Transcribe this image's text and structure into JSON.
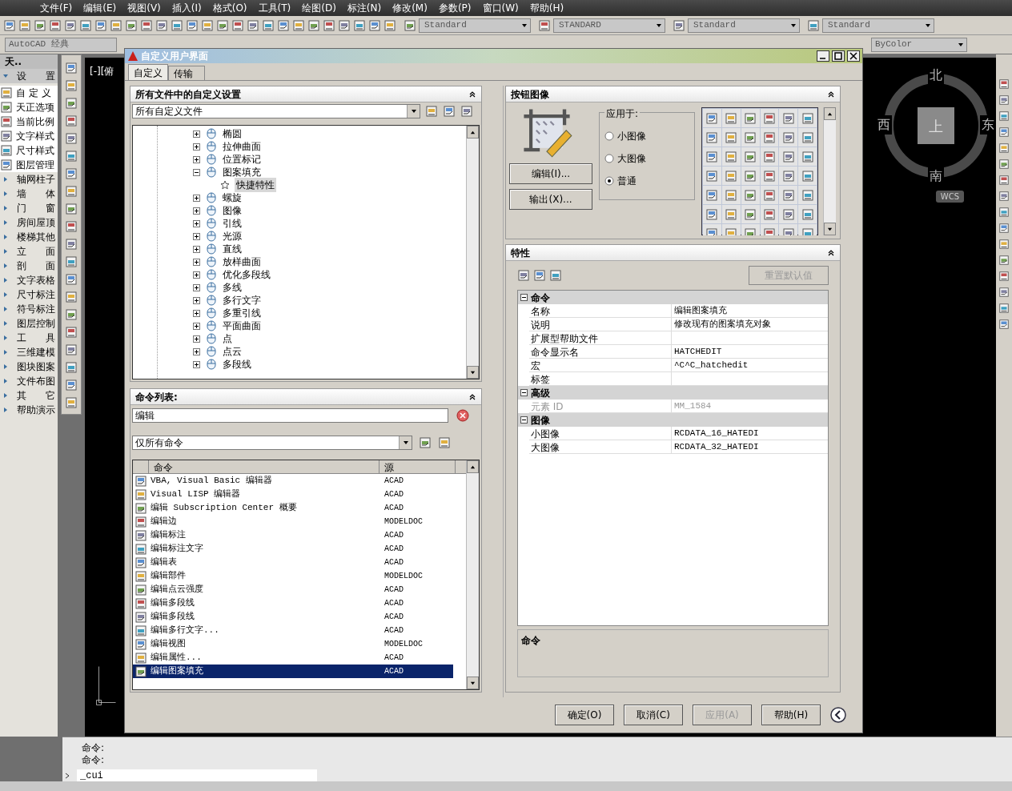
{
  "menu": [
    "文件(F)",
    "编辑(E)",
    "视图(V)",
    "插入(I)",
    "格式(O)",
    "工具(T)",
    "绘图(D)",
    "标注(N)",
    "修改(M)",
    "参数(P)",
    "窗口(W)",
    "帮助(H)"
  ],
  "toolbar": {
    "styles": [
      "Standard",
      "STANDARD",
      "Standard",
      "Standard"
    ],
    "workspace": "AutoCAD 经典",
    "color_control": "ByColor"
  },
  "tianzheng": {
    "title": "天..",
    "items": [
      {
        "kind": "header",
        "label": "设　　置"
      },
      {
        "kind": "tool",
        "label": "自 定 义"
      },
      {
        "kind": "tool",
        "label": "天正选项"
      },
      {
        "kind": "tool",
        "label": "当前比例"
      },
      {
        "kind": "tool",
        "label": "文字样式"
      },
      {
        "kind": "tool",
        "label": "尺寸样式"
      },
      {
        "kind": "tool",
        "label": "图层管理"
      },
      {
        "kind": "menu",
        "label": "轴网柱子"
      },
      {
        "kind": "menu",
        "label": "墙　　体"
      },
      {
        "kind": "menu",
        "label": "门　　窗"
      },
      {
        "kind": "menu",
        "label": "房间屋顶"
      },
      {
        "kind": "menu",
        "label": "楼梯其他"
      },
      {
        "kind": "menu",
        "label": "立　　面"
      },
      {
        "kind": "menu",
        "label": "剖　　面"
      },
      {
        "kind": "menu",
        "label": "文字表格"
      },
      {
        "kind": "menu",
        "label": "尺寸标注"
      },
      {
        "kind": "menu",
        "label": "符号标注"
      },
      {
        "kind": "menu",
        "label": "图层控制"
      },
      {
        "kind": "menu",
        "label": "工　　具"
      },
      {
        "kind": "menu",
        "label": "三维建模"
      },
      {
        "kind": "menu",
        "label": "图块图案"
      },
      {
        "kind": "menu",
        "label": "文件布图"
      },
      {
        "kind": "menu",
        "label": "其　　它"
      },
      {
        "kind": "menu",
        "label": "帮助演示"
      }
    ]
  },
  "viewport": {
    "label": "[-][俯",
    "viewcube": {
      "north": "北",
      "west": "西",
      "east": "东",
      "south": "南",
      "top": "上",
      "ucs": "WCS"
    }
  },
  "dialog": {
    "title": "自定义用户界面",
    "tabs": [
      {
        "label": "自定义",
        "selected": true
      },
      {
        "label": "传输",
        "selected": false
      }
    ],
    "customizations": {
      "title": "所有文件中的自定义设置",
      "file": "所有自定义文件",
      "tree": [
        {
          "label": "椭圆",
          "expanded": false
        },
        {
          "label": "拉伸曲面",
          "expanded": false
        },
        {
          "label": "位置标记",
          "expanded": false
        },
        {
          "label": "图案填充",
          "expanded": true,
          "children": [
            {
              "label": "快捷特性",
              "selected": true
            }
          ]
        },
        {
          "label": "螺旋",
          "expanded": false
        },
        {
          "label": "图像",
          "expanded": false
        },
        {
          "label": "引线",
          "expanded": false
        },
        {
          "label": "光源",
          "expanded": false
        },
        {
          "label": "直线",
          "expanded": false
        },
        {
          "label": "放样曲面",
          "expanded": false
        },
        {
          "label": "优化多段线",
          "expanded": false
        },
        {
          "label": "多线",
          "expanded": false
        },
        {
          "label": "多行文字",
          "expanded": false
        },
        {
          "label": "多重引线",
          "expanded": false
        },
        {
          "label": "平面曲面",
          "expanded": false
        },
        {
          "label": "点",
          "expanded": false
        },
        {
          "label": "点云",
          "expanded": false
        },
        {
          "label": "多段线",
          "expanded": false
        }
      ]
    },
    "command_list": {
      "title": "命令列表:",
      "search": "编辑",
      "filter": "仅所有命令",
      "columns": [
        "命令",
        "源"
      ],
      "rows": [
        {
          "command": "VBA, Visual Basic 编辑器",
          "source": "ACAD",
          "selected": false
        },
        {
          "command": "Visual LISP 编辑器",
          "source": "ACAD",
          "selected": false
        },
        {
          "command": "编辑 Subscription Center 概要",
          "source": "ACAD",
          "selected": false
        },
        {
          "command": "编辑边",
          "source": "MODELDOC",
          "selected": false
        },
        {
          "command": "编辑标注",
          "source": "ACAD",
          "selected": false
        },
        {
          "command": "编辑标注文字",
          "source": "ACAD",
          "selected": false
        },
        {
          "command": "编辑表",
          "source": "ACAD",
          "selected": false
        },
        {
          "command": "编辑部件",
          "source": "MODELDOC",
          "selected": false
        },
        {
          "command": "编辑点云强度",
          "source": "ACAD",
          "selected": false
        },
        {
          "command": "编辑多段线",
          "source": "ACAD",
          "selected": false
        },
        {
          "command": "编辑多段线",
          "source": "ACAD",
          "selected": false
        },
        {
          "command": "编辑多行文字...",
          "source": "ACAD",
          "selected": false
        },
        {
          "command": "编辑视图",
          "source": "MODELDOC",
          "selected": false
        },
        {
          "command": "编辑属性...",
          "source": "ACAD",
          "selected": false
        },
        {
          "command": "编辑图案填充",
          "source": "ACAD",
          "selected": true
        }
      ]
    },
    "button_image": {
      "title": "按钮图像",
      "apply_to": {
        "label": "应用于:",
        "options": [
          {
            "label": "小图像",
            "selected": false
          },
          {
            "label": "大图像",
            "selected": false
          },
          {
            "label": "普通",
            "selected": true
          }
        ]
      },
      "buttons": [
        "编辑(I)...",
        "输出(X)..."
      ]
    },
    "properties": {
      "title": "特性",
      "reset": {
        "label": "重置默认值",
        "disabled": true
      },
      "groups": [
        {
          "label": "命令",
          "rows": [
            {
              "name": "名称",
              "value": "编辑图案填充",
              "disabled": false
            },
            {
              "name": "说明",
              "value": "修改现有的图案填充对象",
              "disabled": false
            },
            {
              "name": "扩展型帮助文件",
              "disabled": false
            },
            {
              "name": "命令显示名",
              "value": "HATCHEDIT",
              "disabled": false
            },
            {
              "name": "宏",
              "value": "^C^C_hatchedit",
              "disabled": false
            },
            {
              "name": "标签",
              "disabled": false
            }
          ]
        },
        {
          "label": "高级",
          "rows": [
            {
              "name": "元素 ID",
              "value": "MM_1584",
              "disabled": true
            }
          ]
        },
        {
          "label": "图像",
          "rows": [
            {
              "name": "小图像",
              "value": "RCDATA_16_HATEDI",
              "disabled": false
            },
            {
              "name": "大图像",
              "value": "RCDATA_32_HATEDI",
              "disabled": false
            }
          ]
        }
      ],
      "description_title": "命令"
    },
    "buttons": [
      {
        "label": "确定(O)",
        "disabled": false
      },
      {
        "label": "取消(C)",
        "disabled": false
      },
      {
        "label": "应用(A)",
        "disabled": true
      },
      {
        "label": "帮助(H)",
        "disabled": false
      }
    ]
  },
  "command_line": {
    "history": [
      "命令:",
      "命令:"
    ],
    "input": "_cui"
  }
}
